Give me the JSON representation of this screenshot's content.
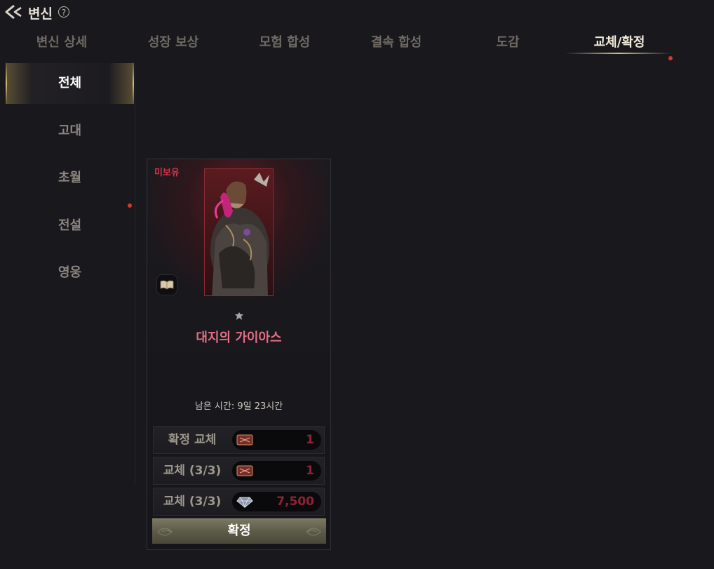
{
  "header": {
    "title": "변신",
    "help_glyph": "?"
  },
  "tabs": [
    {
      "label": "변신 상세",
      "active": false
    },
    {
      "label": "성장 보상",
      "active": false
    },
    {
      "label": "모험 합성",
      "active": false
    },
    {
      "label": "결속 합성",
      "active": false
    },
    {
      "label": "도감",
      "active": false
    },
    {
      "label": "교체/확정",
      "active": true,
      "has_notification": true
    }
  ],
  "sidebar": {
    "items": [
      {
        "label": "전체",
        "active": true
      },
      {
        "label": "고대",
        "active": false
      },
      {
        "label": "초월",
        "active": false
      },
      {
        "label": "전설",
        "active": false,
        "has_notification": true
      },
      {
        "label": "영웅",
        "active": false
      }
    ]
  },
  "card": {
    "badge": "미보유",
    "name": "대지의 가이아스",
    "remaining_time": "남은 시간: 9일 23시간",
    "costs": [
      {
        "label": "확정 교체",
        "icon": "ticket-icon",
        "value": "1"
      },
      {
        "label": "교체 (3/3)",
        "icon": "ticket-icon",
        "value": "1"
      },
      {
        "label": "교체 (3/3)",
        "icon": "diamond-icon",
        "value": "7,500"
      }
    ],
    "confirm_label": "확정"
  },
  "colors": {
    "background": "#19181d",
    "active_tab": "#f0ead9",
    "inactive_tab": "#6f6a63",
    "notification": "#d23a2a",
    "name": "#e56f85",
    "badge": "#d0354a",
    "cost_value": "#8e2334"
  }
}
